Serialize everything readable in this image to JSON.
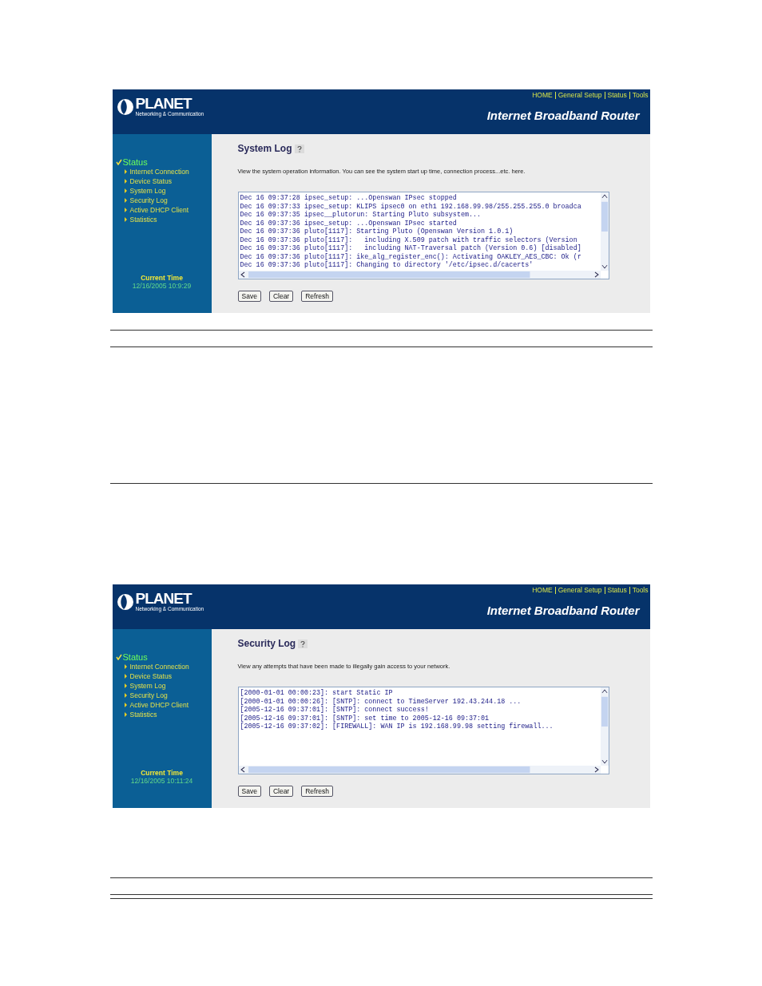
{
  "screens": [
    {
      "logo": {
        "name": "PLANET",
        "tagline": "Networking & Communication"
      },
      "nav_links": [
        "HOME",
        "General Setup",
        "Status",
        "Tools"
      ],
      "product_title": "Internet Broadband Router",
      "sidebar": {
        "section": "Status",
        "items": [
          "Internet Connection",
          "Device Status",
          "System Log",
          "Security Log",
          "Active DHCP Client",
          "Statistics"
        ]
      },
      "current_time": {
        "label": "Current Time",
        "value": "12/16/2005 10:9:29"
      },
      "page": {
        "title": "System Log",
        "description": "View the system operation information. You can see the system start up time, connection process...etc. here.",
        "log_lines": [
          "Dec 16 09:37:28 ipsec_setup: ...Openswan IPsec stopped",
          "Dec 16 09:37:33 ipsec_setup: KLIPS ipsec0 on eth1 192.168.99.98/255.255.255.0 broadca",
          "Dec 16 09:37:35 ipsec__plutorun: Starting Pluto subsystem...",
          "Dec 16 09:37:36 ipsec_setup: ...Openswan IPsec started",
          "Dec 16 09:37:36 pluto[1117]: Starting Pluto (Openswan Version 1.0.1)",
          "Dec 16 09:37:36 pluto[1117]:   including X.509 patch with traffic selectors (Version",
          "Dec 16 09:37:36 pluto[1117]:   including NAT-Traversal patch (Version 0.6) [disabled]",
          "Dec 16 09:37:36 pluto[1117]: ike_alg_register_enc(): Activating OAKLEY_AES_CBC: Ok (r",
          "Dec 16 09:37:36 pluto[1117]: Changing to directory '/etc/ipsec.d/cacerts'"
        ],
        "buttons": [
          "Save",
          "Clear",
          "Refresh"
        ]
      }
    },
    {
      "logo": {
        "name": "PLANET",
        "tagline": "Networking & Communication"
      },
      "nav_links": [
        "HOME",
        "General Setup",
        "Status",
        "Tools"
      ],
      "product_title": "Internet Broadband Router",
      "sidebar": {
        "section": "Status",
        "items": [
          "Internet Connection",
          "Device Status",
          "System Log",
          "Security Log",
          "Active DHCP Client",
          "Statistics"
        ]
      },
      "current_time": {
        "label": "Current Time",
        "value": "12/16/2005 10:11:24"
      },
      "page": {
        "title": "Security Log",
        "description": "View any attempts that have been made to illegally gain access to your network.",
        "log_lines": [
          "[2000-01-01 00:00:23]: start Static IP",
          "[2000-01-01 00:00:26]: [SNTP]: connect to TimeServer 192.43.244.18 ...",
          "[2005-12-16 09:37:01]: [SNTP]: connect success!",
          "[2005-12-16 09:37:01]: [SNTP]: set time to 2005-12-16 09:37:01",
          "[2005-12-16 09:37:02]: [FIREWALL]: WAN IP is 192.168.99.98 setting firewall..."
        ],
        "buttons": [
          "Save",
          "Clear",
          "Refresh"
        ]
      }
    }
  ]
}
